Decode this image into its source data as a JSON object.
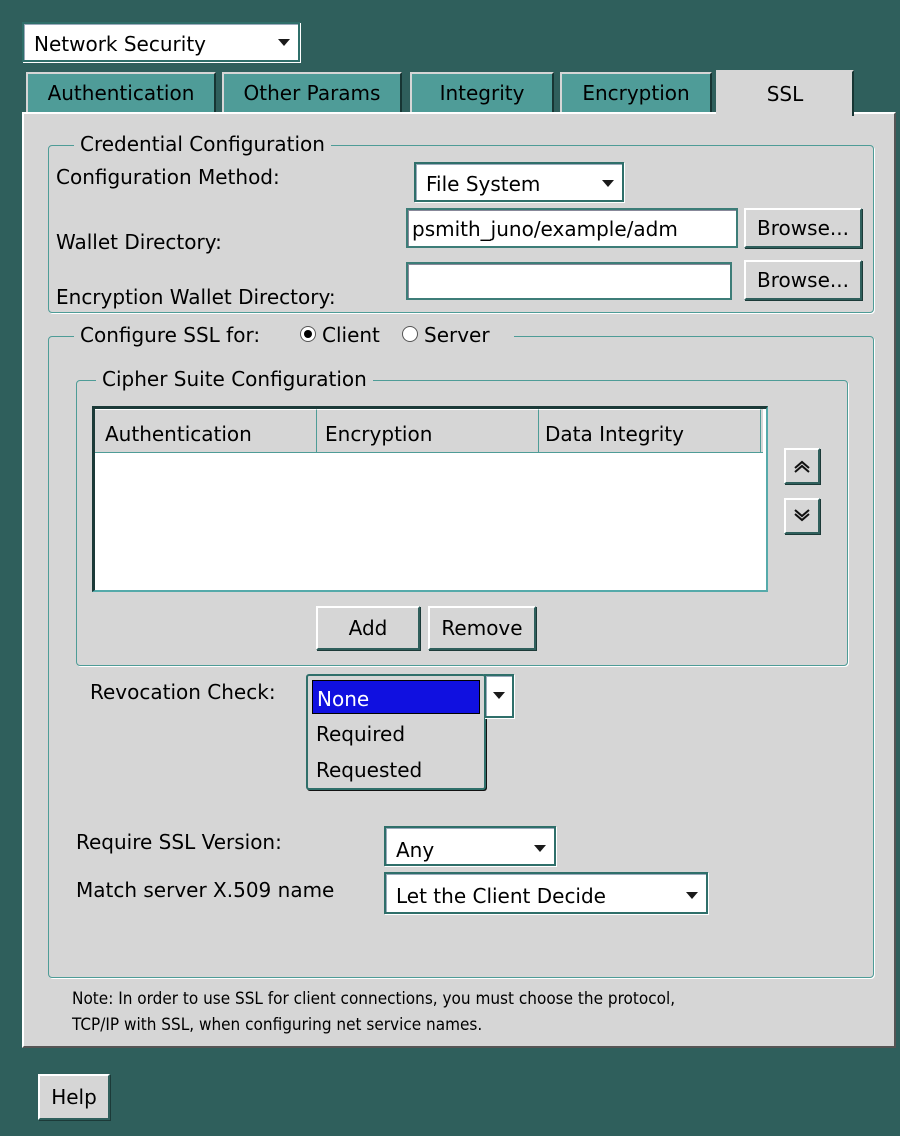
{
  "category_select": {
    "value": "Network Security"
  },
  "tabs": [
    {
      "label": "Authentication"
    },
    {
      "label": "Other Params"
    },
    {
      "label": "Integrity"
    },
    {
      "label": "Encryption"
    },
    {
      "label": "SSL"
    }
  ],
  "credential": {
    "legend": "Credential Configuration",
    "method_label": "Configuration Method:",
    "method_value": "File System",
    "wallet_label": "Wallet Directory:",
    "wallet_value": "psmith_juno/example/adm",
    "enc_wallet_label": "Encryption Wallet Directory:",
    "enc_wallet_value": "",
    "browse_label": "Browse..."
  },
  "ssl_for": {
    "legend": "Configure SSL for:",
    "client_label": "Client",
    "server_label": "Server",
    "selected": "Client"
  },
  "cipher": {
    "legend": "Cipher Suite Configuration",
    "columns": [
      "Authentication",
      "Encryption",
      "Data Integrity"
    ],
    "rows": [],
    "add_label": "Add",
    "remove_label": "Remove"
  },
  "revocation": {
    "label": "Revocation Check:",
    "options": [
      "None",
      "Required",
      "Requested"
    ],
    "selected": "None"
  },
  "ssl_version": {
    "label": "Require SSL Version:",
    "value": "Any"
  },
  "match_name": {
    "label": "Match server X.509 name",
    "value": "Let the Client Decide"
  },
  "note": {
    "line1": "Note: In order to use SSL for client connections, you must choose the protocol,",
    "line2": "TCP/IP with SSL, when configuring net service names."
  },
  "help_label": "Help",
  "colors": {
    "background": "#2f5f5c",
    "panel": "#d6d6d6",
    "tab": "#4f9c98",
    "selection": "#1010e0"
  }
}
